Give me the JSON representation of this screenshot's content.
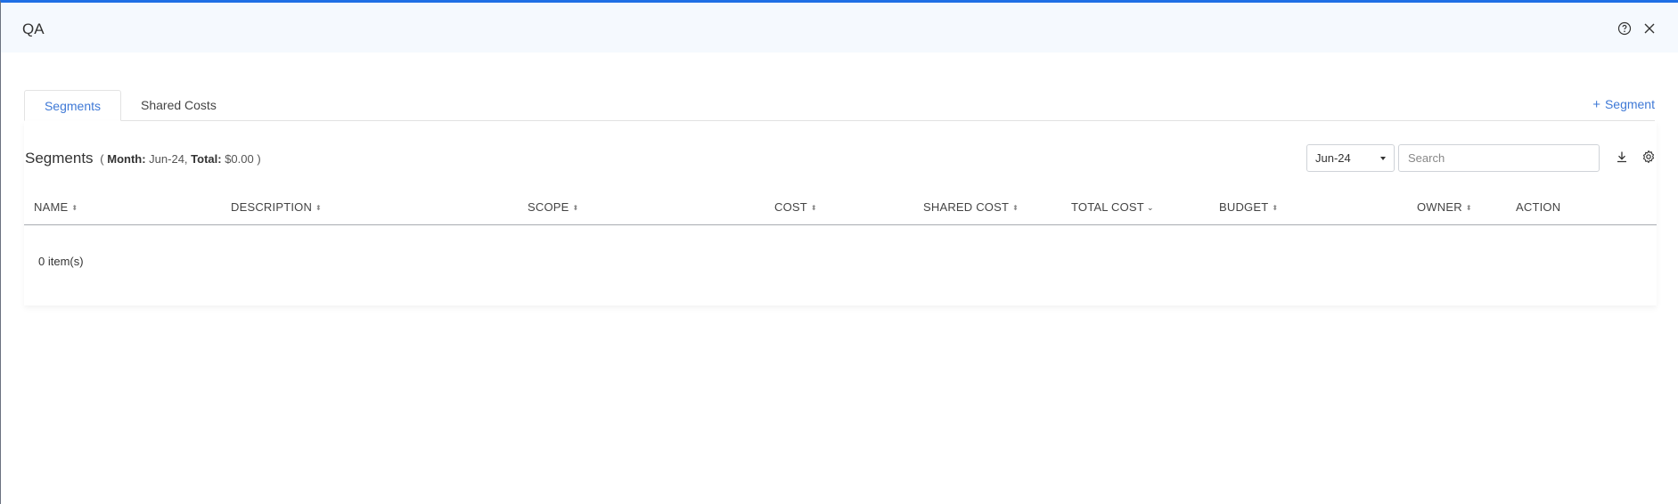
{
  "window": {
    "title": "QA"
  },
  "tabs": [
    {
      "label": "Segments",
      "active": true
    },
    {
      "label": "Shared Costs",
      "active": false
    }
  ],
  "add_segment": {
    "label": "Segment"
  },
  "segments": {
    "title": "Segments",
    "month_label": "Month:",
    "month_value": "Jun-24",
    "total_label": "Total:",
    "total_value": "$0.00"
  },
  "filters": {
    "month_selected": "Jun-24",
    "search_placeholder": "Search",
    "search_value": ""
  },
  "table": {
    "columns": [
      {
        "label": "NAME",
        "sort": "none"
      },
      {
        "label": "DESCRIPTION",
        "sort": "none"
      },
      {
        "label": "SCOPE",
        "sort": "none"
      },
      {
        "label": "COST",
        "sort": "none"
      },
      {
        "label": "SHARED COST",
        "sort": "none"
      },
      {
        "label": "TOTAL COST",
        "sort": "desc"
      },
      {
        "label": "BUDGET",
        "sort": "none"
      },
      {
        "label": "OWNER",
        "sort": "none"
      },
      {
        "label": "ACTION",
        "sort": null
      }
    ],
    "rows": [],
    "item_count": "0 item(s)"
  },
  "colors": {
    "accent": "#3f79d6",
    "top_bar": "#1f6fe5",
    "header_bg": "#f5f9fe"
  }
}
